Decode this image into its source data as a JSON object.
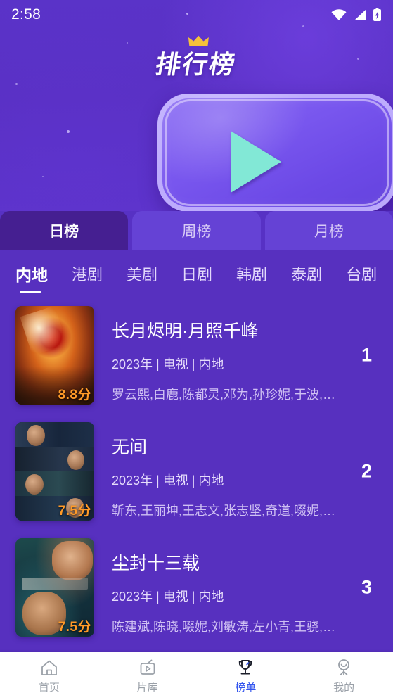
{
  "status_bar": {
    "time": "2:58",
    "icons": [
      "wifi-icon",
      "signal-icon",
      "battery-icon"
    ]
  },
  "header": {
    "title": "排行榜",
    "crown_icon": "crown-icon",
    "play_icon": "play-triangle-icon",
    "accent_color": "#67e3cd",
    "background_color": "#5731c4"
  },
  "period_tabs": {
    "active_index": 0,
    "items": [
      {
        "label": "日榜",
        "active": true
      },
      {
        "label": "周榜",
        "active": false
      },
      {
        "label": "月榜",
        "active": false
      }
    ]
  },
  "category_tabs": {
    "active_index": 0,
    "items": [
      {
        "label": "内地",
        "active": true
      },
      {
        "label": "港剧",
        "active": false
      },
      {
        "label": "美剧",
        "active": false
      },
      {
        "label": "日剧",
        "active": false
      },
      {
        "label": "韩剧",
        "active": false
      },
      {
        "label": "泰剧",
        "active": false
      },
      {
        "label": "台剧",
        "active": false
      }
    ]
  },
  "list": {
    "items": [
      {
        "rank": "1",
        "title": "长月烬明·月照千峰",
        "meta": "2023年 | 电视 | 内地",
        "cast": "罗云熙,白鹿,陈都灵,邓为,孙珍妮,于波,…",
        "rating": "8.8分",
        "poster": "poster-fiery-phoenix"
      },
      {
        "rank": "2",
        "title": "无间",
        "meta": "2023年 | 电视 | 内地",
        "cast": "靳东,王丽坤,王志文,张志坚,奇道,啜妮,…",
        "rating": "7.5分",
        "poster": "poster-dark-strips"
      },
      {
        "rank": "3",
        "title": "尘封十三载",
        "meta": "2023年 | 电视 | 内地",
        "cast": "陈建斌,陈晓,啜妮,刘敏涛,左小青,王骁,…",
        "rating": "7.5分",
        "poster": "poster-teal-portraits"
      }
    ],
    "rating_color": "#ff9a28"
  },
  "bottom_nav": {
    "active_index": 2,
    "active_color": "#3355ee",
    "inactive_color": "#9aa0a8",
    "items": [
      {
        "label": "首页",
        "icon": "home-icon",
        "active": false
      },
      {
        "label": "片库",
        "icon": "tv-play-icon",
        "active": false
      },
      {
        "label": "榜单",
        "icon": "trophy-icon",
        "active": true
      },
      {
        "label": "我的",
        "icon": "person-icon",
        "active": false
      }
    ]
  }
}
